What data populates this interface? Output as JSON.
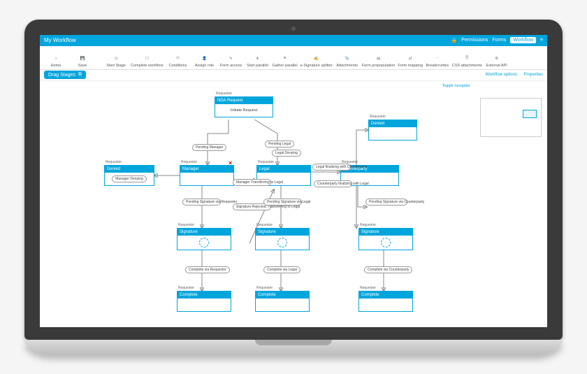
{
  "titlebar": {
    "title": "My Workflow",
    "right": {
      "permissions": "Permissions",
      "forms": "Forms",
      "workflow": "Workflow"
    }
  },
  "toolbar": {
    "home": "Home",
    "save": "Save",
    "start_stage": "Start Stage",
    "complete_workflow": "Complete workflow",
    "conditions": "Conditions",
    "assign_role": "Assign role",
    "form_access": "Form access",
    "start_parallel": "Start parallel",
    "gather_parallel": "Gather parallel",
    "e_signature_splitter": "e-Signature splitter",
    "attachments": "Attachments",
    "form_prepopulation": "Form prepopulation",
    "form_mapping": "Form mapping",
    "breadcrumbs": "Breadcrumbs",
    "css_attachments": "CSS attachments",
    "external_api": "External API"
  },
  "subbar": {
    "drag_stages": "Drag Stages",
    "workflow_options": "Workflow options",
    "properties": "Properties"
  },
  "canvas": {
    "toggle_navigator": "Toggle navigator"
  },
  "roles": {
    "requester": "Requester"
  },
  "nodes": {
    "nda_request": {
      "title": "NDA Request",
      "body": "Initiate Request"
    },
    "denied_top": {
      "title": "Denied",
      "body": ""
    },
    "denied_left": {
      "title": "Denied",
      "body": "Manager Denying"
    },
    "manager": {
      "title": "Manager",
      "body": ""
    },
    "legal": {
      "title": "Legal",
      "body": ""
    },
    "counterparty_hdr": {
      "title": "Counterparty",
      "body": ""
    },
    "signature_l": {
      "title": "Signature",
      "body": ""
    },
    "signature_m": {
      "title": "Signature",
      "body": ""
    },
    "signature_r": {
      "title": "Signature",
      "body": ""
    },
    "complete_l": {
      "title": "Complete",
      "body": ""
    },
    "complete_m": {
      "title": "Complete",
      "body": ""
    },
    "complete_r": {
      "title": "Complete",
      "body": ""
    }
  },
  "edge_labels": {
    "pending_manager": "Pending Manager",
    "pending_legal": "Pending Legal",
    "legal_denying": "Legal Denying",
    "manager_transferring": "Manager Transferring to Legal",
    "legal_cp": "Legal finalizing with Counterparty",
    "cp_legal": "Counterparty finalizing with Legal",
    "pending_sig_requester": "Pending Signature via Requester",
    "sig_rejected": "Signature Rejected: Transferring to Legal",
    "pending_sig_legal": "Pending Signature via Legal",
    "pending_sig_cp": "Pending Signature via Counterparty",
    "complete_requester": "Complete via Requester",
    "complete_legal": "Complete via Legal",
    "complete_cp": "Complete via Counterparty"
  }
}
